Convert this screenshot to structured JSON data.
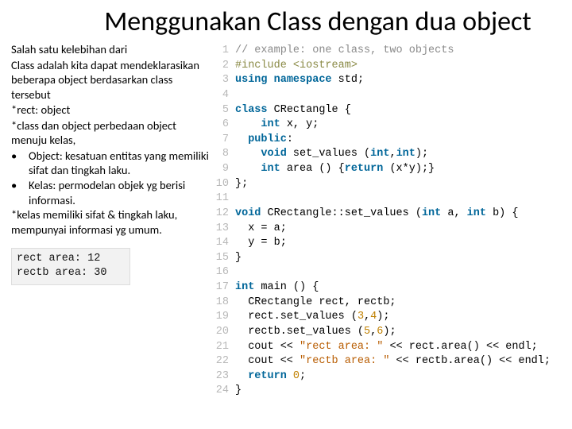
{
  "title": "Menggunakan Class dengan dua object",
  "left": {
    "p1": "Salah satu kelebihan dari",
    "p2": "Class adalah kita dapat mendeklarasikan beberapa object berdasarkan class tersebut",
    "p3": "*rect: object",
    "p4": "*class dan object perbedaan object menuju kelas,",
    "b1": "Object: kesatuan entitas yang memiliki sifat dan tingkah laku.",
    "b2": "Kelas: permodelan objek yg berisi informasi.",
    "p5": "*kelas memiliki sifat & tingkah laku, mempunyai informasi yg umum."
  },
  "output": {
    "l1": "rect area: 12",
    "l2": "rectb area: 30"
  },
  "code": [
    {
      "n": "1",
      "segs": [
        {
          "c": "c-comment",
          "t": "// example: one class, two objects"
        }
      ]
    },
    {
      "n": "2",
      "segs": [
        {
          "c": "c-pre",
          "t": "#include <iostream>"
        }
      ]
    },
    {
      "n": "3",
      "segs": [
        {
          "c": "c-kw",
          "t": "using"
        },
        {
          "t": " "
        },
        {
          "c": "c-kw",
          "t": "namespace"
        },
        {
          "t": " std;"
        }
      ]
    },
    {
      "n": "4",
      "segs": [
        {
          "t": ""
        }
      ]
    },
    {
      "n": "5",
      "segs": [
        {
          "c": "c-kw",
          "t": "class"
        },
        {
          "t": " CRectangle {"
        }
      ]
    },
    {
      "n": "6",
      "segs": [
        {
          "t": "    "
        },
        {
          "c": "c-kw",
          "t": "int"
        },
        {
          "t": " x, y;"
        }
      ]
    },
    {
      "n": "7",
      "segs": [
        {
          "t": "  "
        },
        {
          "c": "c-kw",
          "t": "public"
        },
        {
          "t": ":"
        }
      ]
    },
    {
      "n": "8",
      "segs": [
        {
          "t": "    "
        },
        {
          "c": "c-kw",
          "t": "void"
        },
        {
          "t": " set_values ("
        },
        {
          "c": "c-kw",
          "t": "int"
        },
        {
          "t": ","
        },
        {
          "c": "c-kw",
          "t": "int"
        },
        {
          "t": ");"
        }
      ]
    },
    {
      "n": "9",
      "segs": [
        {
          "t": "    "
        },
        {
          "c": "c-kw",
          "t": "int"
        },
        {
          "t": " area () {"
        },
        {
          "c": "c-kw",
          "t": "return"
        },
        {
          "t": " (x*y);}"
        }
      ]
    },
    {
      "n": "10",
      "segs": [
        {
          "t": "};"
        }
      ]
    },
    {
      "n": "11",
      "segs": [
        {
          "t": ""
        }
      ]
    },
    {
      "n": "12",
      "segs": [
        {
          "c": "c-kw",
          "t": "void"
        },
        {
          "t": " CRectangle::set_values ("
        },
        {
          "c": "c-kw",
          "t": "int"
        },
        {
          "t": " a, "
        },
        {
          "c": "c-kw",
          "t": "int"
        },
        {
          "t": " b) {"
        }
      ]
    },
    {
      "n": "13",
      "segs": [
        {
          "t": "  x = a;"
        }
      ]
    },
    {
      "n": "14",
      "segs": [
        {
          "t": "  y = b;"
        }
      ]
    },
    {
      "n": "15",
      "segs": [
        {
          "t": "}"
        }
      ]
    },
    {
      "n": "16",
      "segs": [
        {
          "t": ""
        }
      ]
    },
    {
      "n": "17",
      "segs": [
        {
          "c": "c-kw",
          "t": "int"
        },
        {
          "t": " main () {"
        }
      ]
    },
    {
      "n": "18",
      "segs": [
        {
          "t": "  CRectangle rect, rectb;"
        }
      ]
    },
    {
      "n": "19",
      "segs": [
        {
          "t": "  rect.set_values ("
        },
        {
          "c": "c-num",
          "t": "3"
        },
        {
          "t": ","
        },
        {
          "c": "c-num",
          "t": "4"
        },
        {
          "t": ");"
        }
      ]
    },
    {
      "n": "20",
      "segs": [
        {
          "t": "  rectb.set_values ("
        },
        {
          "c": "c-num",
          "t": "5"
        },
        {
          "t": ","
        },
        {
          "c": "c-num",
          "t": "6"
        },
        {
          "t": ");"
        }
      ]
    },
    {
      "n": "21",
      "segs": [
        {
          "t": "  cout << "
        },
        {
          "c": "c-str",
          "t": "\"rect area: \""
        },
        {
          "t": " << rect.area() << endl;"
        }
      ]
    },
    {
      "n": "22",
      "segs": [
        {
          "t": "  cout << "
        },
        {
          "c": "c-str",
          "t": "\"rectb area: \""
        },
        {
          "t": " << rectb.area() << endl;"
        }
      ]
    },
    {
      "n": "23",
      "segs": [
        {
          "t": "  "
        },
        {
          "c": "c-kw",
          "t": "return"
        },
        {
          "t": " "
        },
        {
          "c": "c-num",
          "t": "0"
        },
        {
          "t": ";"
        }
      ]
    },
    {
      "n": "24",
      "segs": [
        {
          "t": "}"
        }
      ]
    }
  ]
}
